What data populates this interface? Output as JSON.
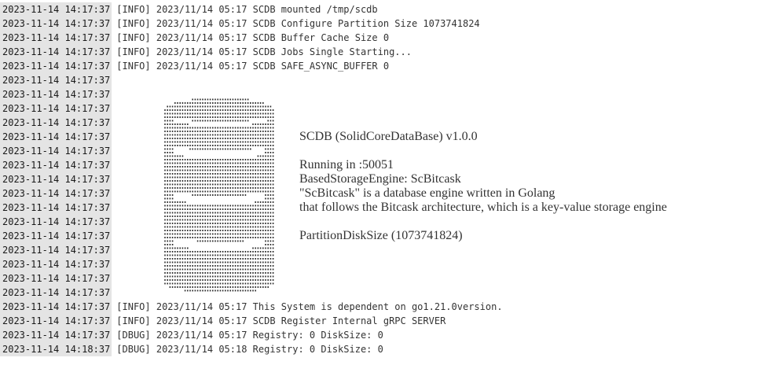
{
  "log": {
    "lines": [
      {
        "ts": "2023-11-14 14:17:37",
        "msg": "[INFO] 2023/11/14 05:17 SCDB mounted /tmp/scdb"
      },
      {
        "ts": "2023-11-14 14:17:37",
        "msg": "[INFO] 2023/11/14 05:17 SCDB Configure Partition Size 1073741824"
      },
      {
        "ts": "2023-11-14 14:17:37",
        "msg": "[INFO] 2023/11/14 05:17 SCDB Buffer Cache Size 0"
      },
      {
        "ts": "2023-11-14 14:17:37",
        "msg": "[INFO] 2023/11/14 05:17 SCDB Jobs Single Starting..."
      },
      {
        "ts": "2023-11-14 14:17:37",
        "msg": "[INFO] 2023/11/14 05:17 SCDB SAFE_ASYNC_BUFFER 0"
      },
      {
        "ts": "2023-11-14 14:17:37",
        "msg": ""
      },
      {
        "ts": "2023-11-14 14:17:37",
        "msg": ""
      },
      {
        "ts": "2023-11-14 14:17:37",
        "msg": ""
      },
      {
        "ts": "2023-11-14 14:17:37",
        "msg": ""
      },
      {
        "ts": "2023-11-14 14:17:37",
        "msg": ""
      },
      {
        "ts": "2023-11-14 14:17:37",
        "msg": ""
      },
      {
        "ts": "2023-11-14 14:17:37",
        "msg": ""
      },
      {
        "ts": "2023-11-14 14:17:37",
        "msg": ""
      },
      {
        "ts": "2023-11-14 14:17:37",
        "msg": ""
      },
      {
        "ts": "2023-11-14 14:17:37",
        "msg": ""
      },
      {
        "ts": "2023-11-14 14:17:37",
        "msg": ""
      },
      {
        "ts": "2023-11-14 14:17:37",
        "msg": ""
      },
      {
        "ts": "2023-11-14 14:17:37",
        "msg": ""
      },
      {
        "ts": "2023-11-14 14:17:37",
        "msg": ""
      },
      {
        "ts": "2023-11-14 14:17:37",
        "msg": ""
      },
      {
        "ts": "2023-11-14 14:17:37",
        "msg": ""
      },
      {
        "ts": "2023-11-14 14:17:37",
        "msg": "[INFO] 2023/11/14 05:17 This System is dependent on go1.21.0version."
      },
      {
        "ts": "2023-11-14 14:17:37",
        "msg": "[INFO] 2023/11/14 05:17 SCDB Register Internal gRPC SERVER"
      },
      {
        "ts": "2023-11-14 14:17:37",
        "msg": "[DBUG] 2023/11/14 05:17 Registry: 0 DiskSize: 0"
      },
      {
        "ts": "2023-11-14 14:18:37",
        "msg": "[DBUG] 2023/11/14 05:18 Registry: 0 DiskSize: 0"
      }
    ]
  },
  "banner": {
    "title": "SCDB (SolidCoreDataBase) v1.0.0",
    "running": "Running in :50051",
    "engine": "BasedStorageEngine: ScBitcask",
    "desc1": "\"ScBitcask\" is a database engine written in Golang",
    "desc2": "that follows the Bitcask architecture, which is a key-value storage engine",
    "partition": "PartitionDiskSize (1073741824)"
  },
  "icons": {
    "logo": "database-cylinder-icon"
  }
}
